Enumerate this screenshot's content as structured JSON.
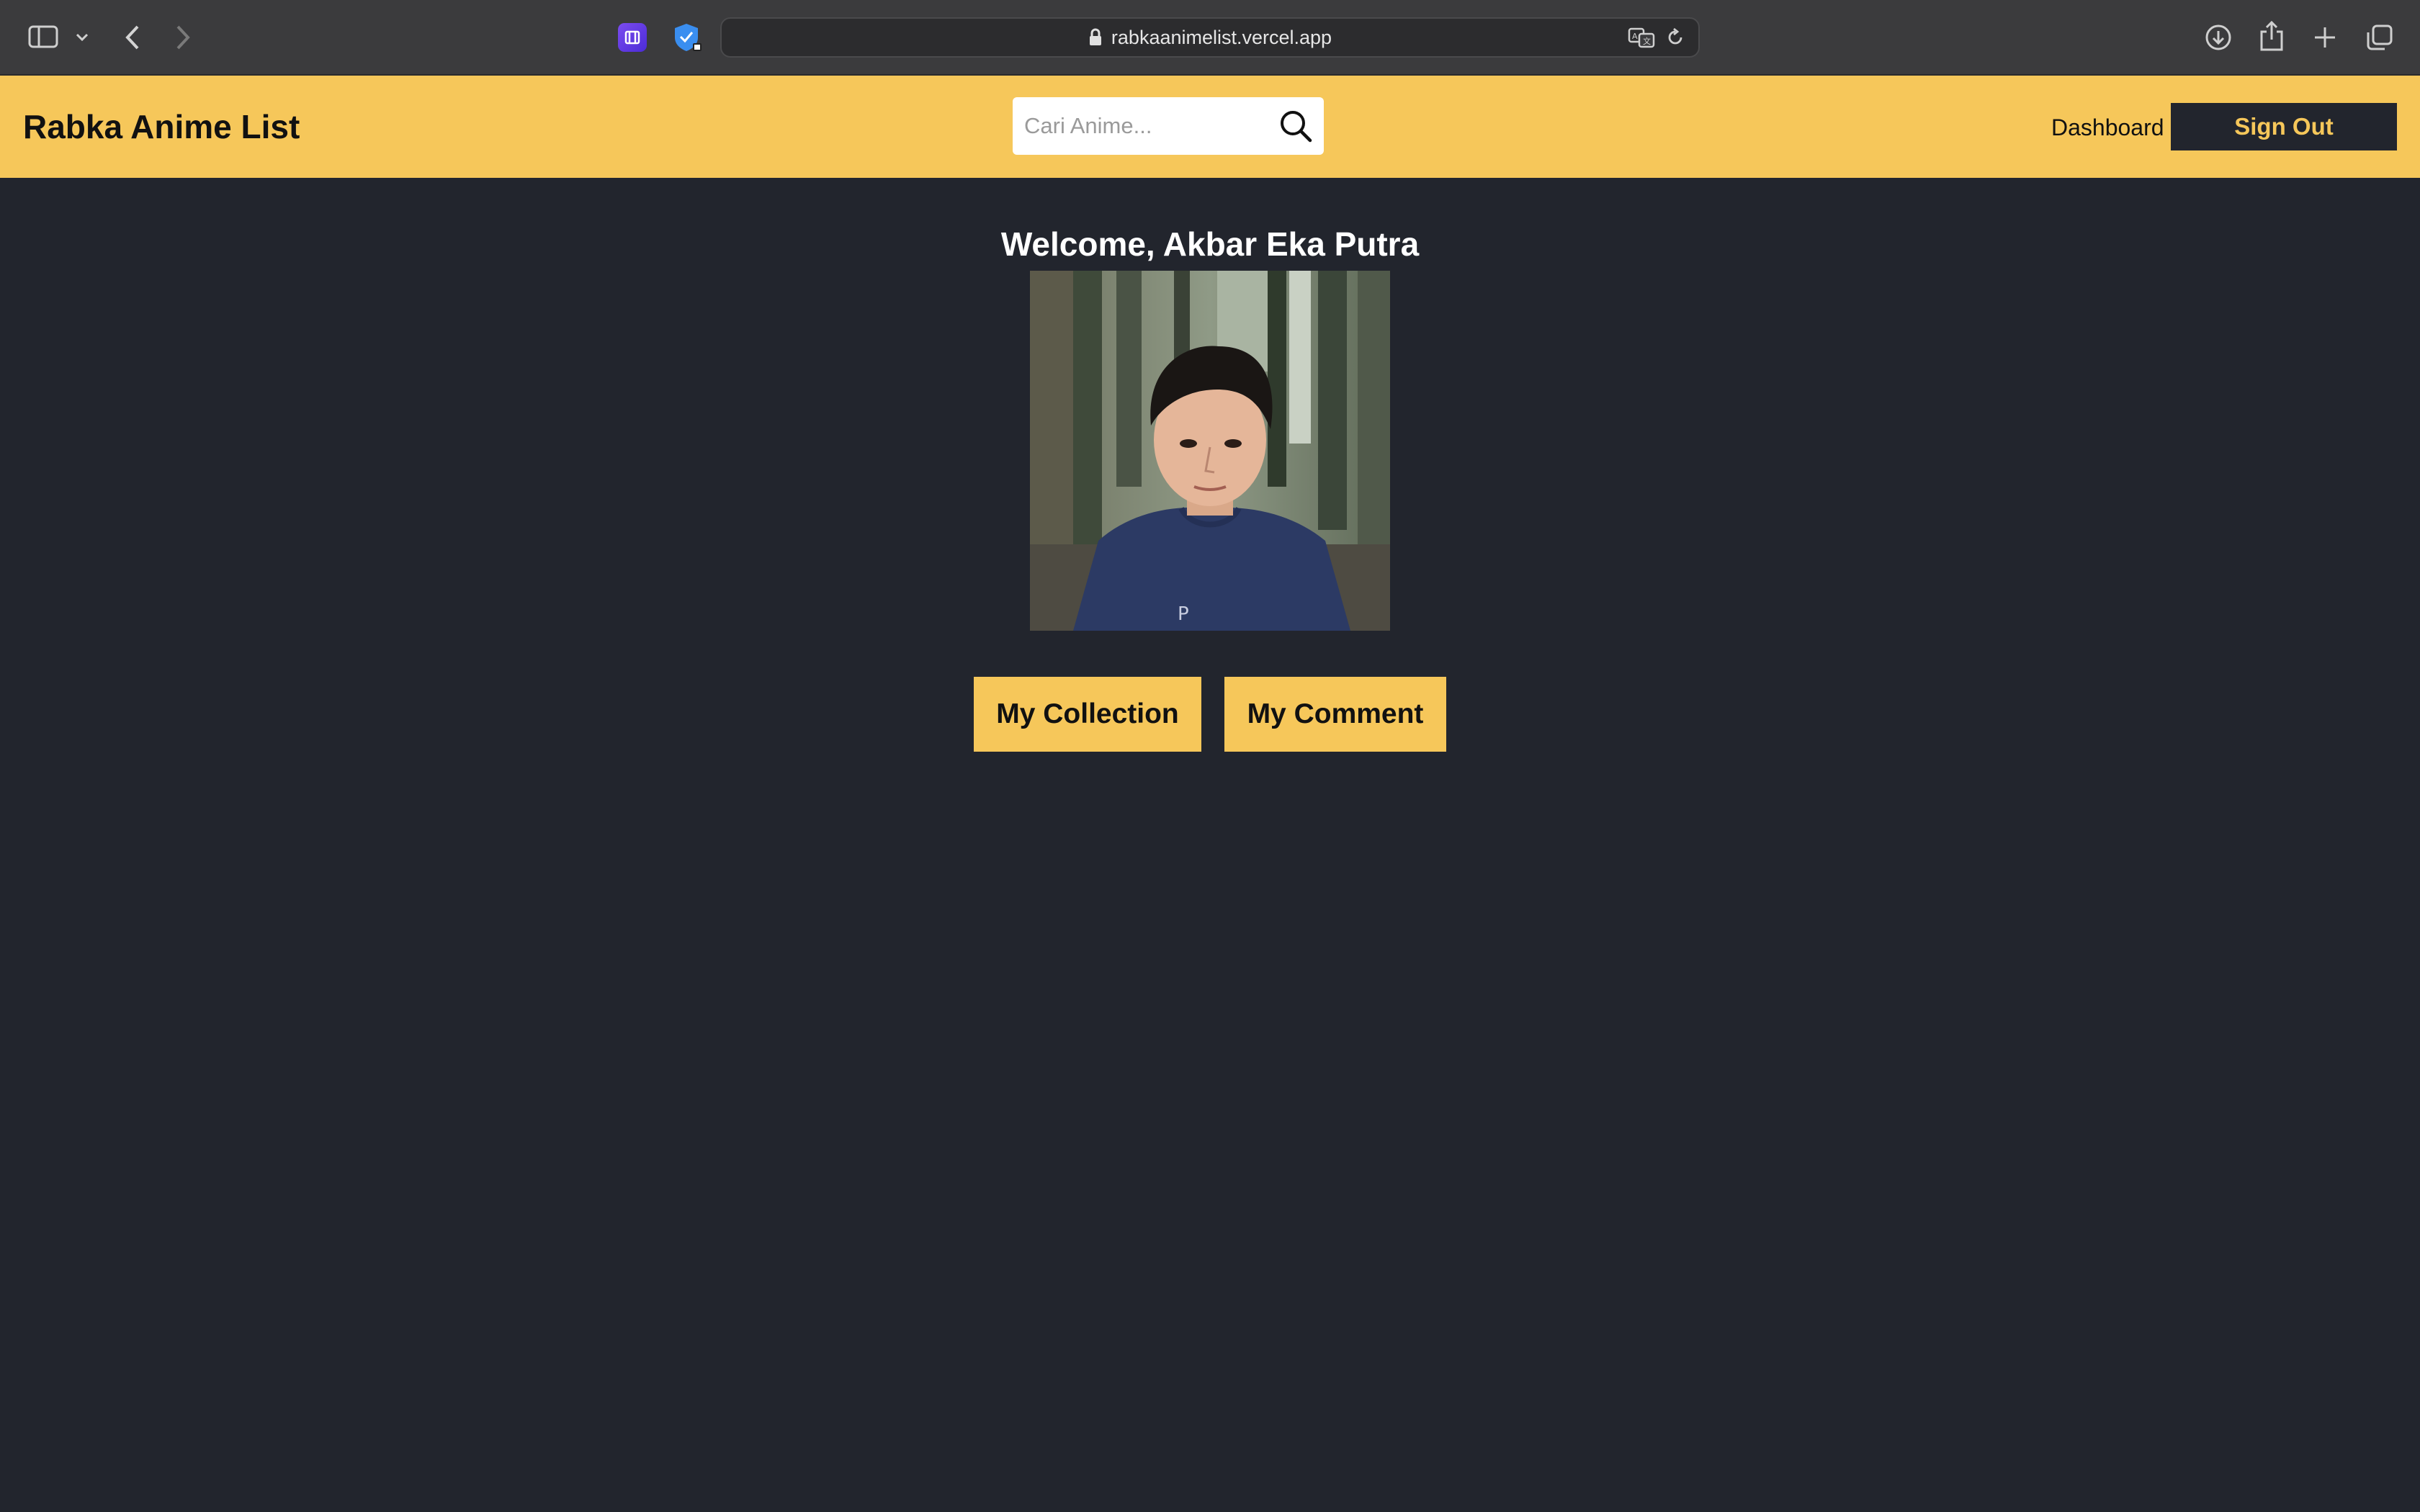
{
  "browser": {
    "url": "rabkaanimelist.vercel.app",
    "icons": [
      "sidebar-icon",
      "chevron-down-icon",
      "back-icon",
      "forward-icon",
      "extension-icon",
      "shield-extension-icon",
      "lock-icon",
      "translate-icon",
      "reload-icon",
      "download-icon",
      "share-icon",
      "new-tab-icon",
      "tabs-overview-icon"
    ]
  },
  "header": {
    "brand": "Rabka Anime List",
    "search_placeholder": "Cari Anime...",
    "nav_dashboard": "Dashboard",
    "sign_out": "Sign Out"
  },
  "profile": {
    "welcome": "Welcome, Akbar Eka Putra",
    "avatar_alt": "Akbar Eka Putra",
    "buttons": {
      "collection": "My Collection",
      "comment": "My Comment"
    }
  },
  "colors": {
    "accent": "#f6c75a",
    "background": "#22252d",
    "chrome": "#3b3b3d"
  }
}
